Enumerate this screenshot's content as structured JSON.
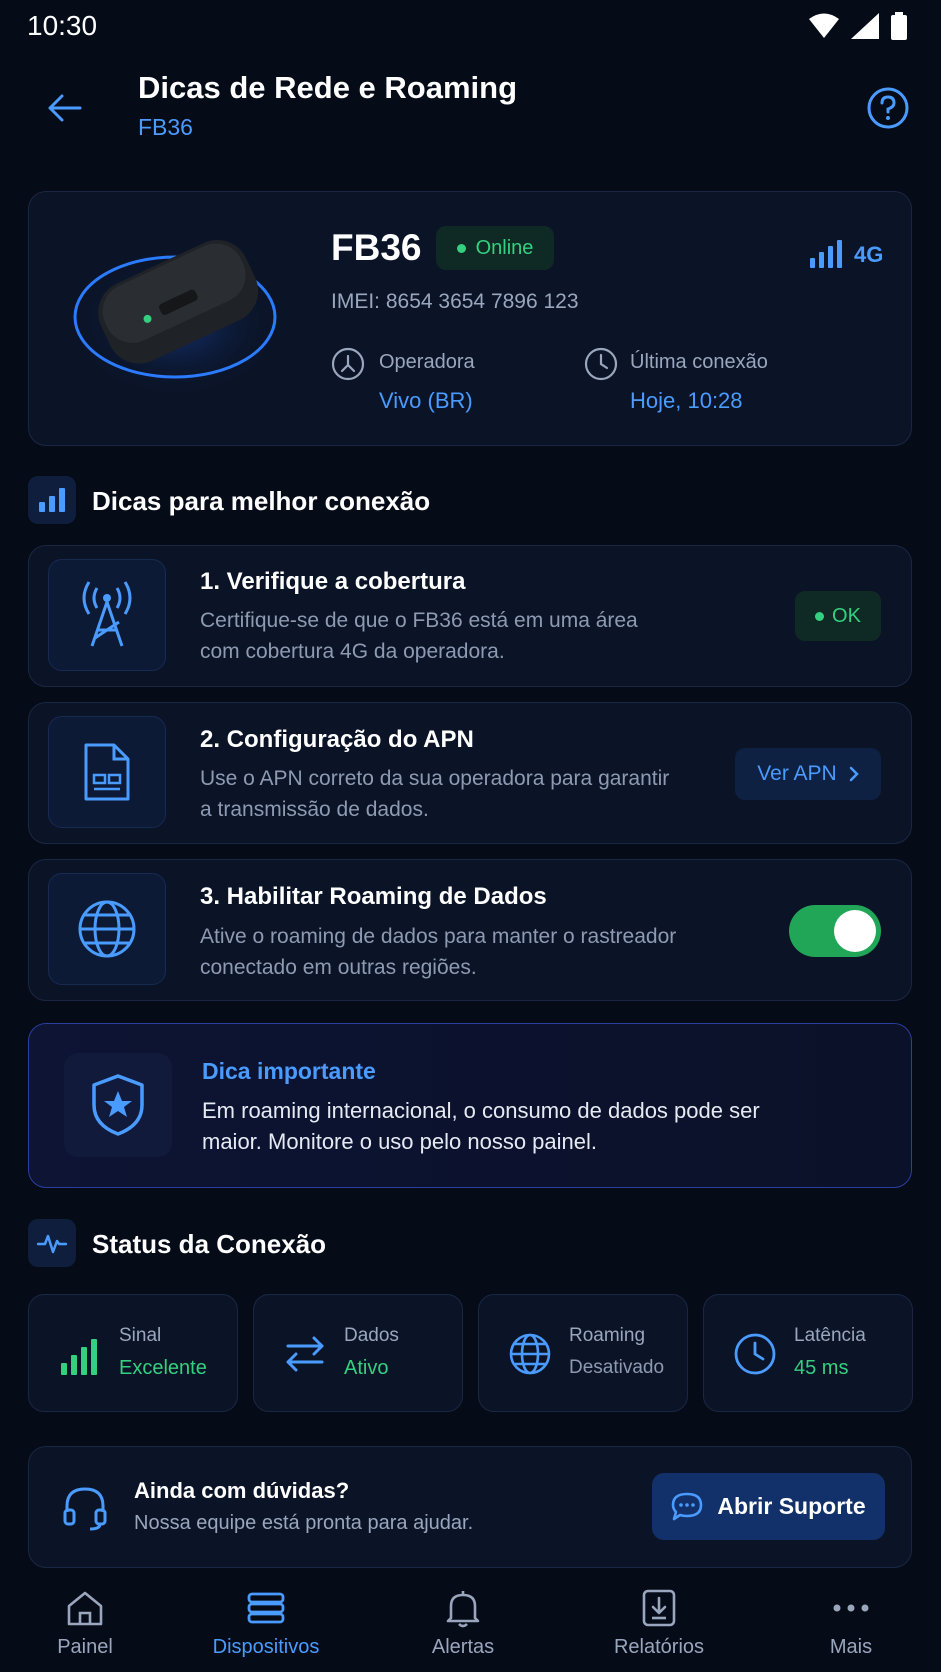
{
  "status_bar": {
    "time": "10:30"
  },
  "header": {
    "title": "Dicas de Rede e Roaming",
    "subtitle": "FB36"
  },
  "device": {
    "name": "FB36",
    "status": "Online",
    "network": "4G",
    "imei": "IMEI: 8654 3654 7896 123",
    "operator_label": "Operadora",
    "operator_value": "Vivo (BR)",
    "last_conn_label": "Última conexão",
    "last_conn_value": "Hoje, 10:28"
  },
  "tips_section": {
    "title": "Dicas para melhor conexão"
  },
  "tips": [
    {
      "title": "1. Verifique a cobertura",
      "desc": "Certifique-se de que o FB36 está em uma área com cobertura 4G da operadora.",
      "badge": "OK"
    },
    {
      "title": "2. Configuração do APN",
      "desc": "Use o APN correto da sua operadora para garantir a transmissão de dados.",
      "button": "Ver APN"
    },
    {
      "title": "3. Habilitar Roaming de Dados",
      "desc": "Ative o roaming de dados para manter o rastreador conectado em outras regiões.",
      "toggle_on": true
    }
  ],
  "important": {
    "title": "Dica importante",
    "desc": "Em roaming internacional, o consumo de dados pode ser maior. Monitore o uso pelo nosso painel."
  },
  "status_section": {
    "title": "Status da Conexão"
  },
  "stats": [
    {
      "label": "Sinal",
      "value": "Excelente",
      "color": "#35d07f"
    },
    {
      "label": "Dados",
      "value": "Ativo",
      "color": "#35d07f"
    },
    {
      "label": "Roaming",
      "value": "Desativado",
      "color": "#8e9ab2"
    },
    {
      "label": "Latência",
      "value": "45 ms",
      "color": "#35d07f"
    }
  ],
  "support": {
    "title": "Ainda com dúvidas?",
    "subtitle": "Nossa equipe está pronta para ajudar.",
    "button": "Abrir Suporte"
  },
  "nav": [
    {
      "label": "Painel",
      "icon": "home-icon"
    },
    {
      "label": "Dispositivos",
      "icon": "devices-icon",
      "active": true
    },
    {
      "label": "Alertas",
      "icon": "bell-icon"
    },
    {
      "label": "Relatórios",
      "icon": "report-icon"
    },
    {
      "label": "Mais",
      "icon": "more-icon"
    }
  ],
  "colors": {
    "accent": "#4a9bff",
    "success": "#35d07f",
    "background": "#060b18"
  }
}
